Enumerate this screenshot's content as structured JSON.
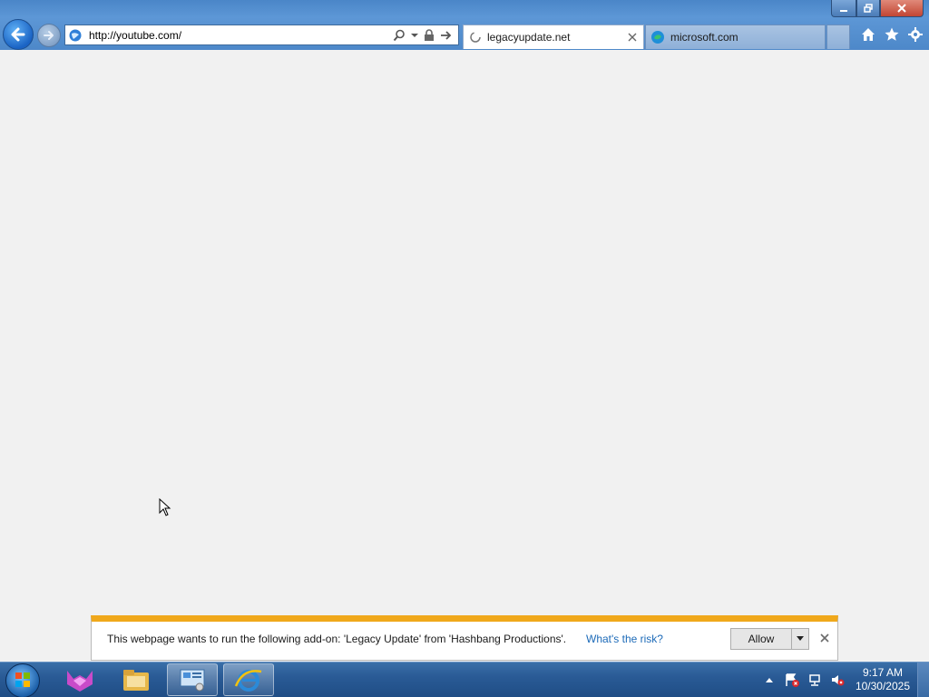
{
  "browser": {
    "address_url": "http://youtube.com/",
    "tabs": [
      {
        "label": "legacyupdate.net",
        "state": "loading",
        "active": true
      },
      {
        "label": "microsoft.com",
        "active": false
      }
    ],
    "toolbar_icons": [
      "home-icon",
      "favorites-star-icon",
      "tools-gear-icon"
    ]
  },
  "notification": {
    "message": "This webpage wants to run the following add-on: 'Legacy Update' from 'Hashbang Productions'.",
    "risk_link": "What's the risk?",
    "allow_label": "Allow",
    "accent_color": "#f0a81b"
  },
  "taskbar": {
    "apps": [
      "purple-fox-app-icon",
      "file-explorer-icon",
      "control-panel-icon",
      "internet-explorer-icon"
    ],
    "clock_time": "9:17 AM",
    "clock_date": "10/30/2025"
  }
}
